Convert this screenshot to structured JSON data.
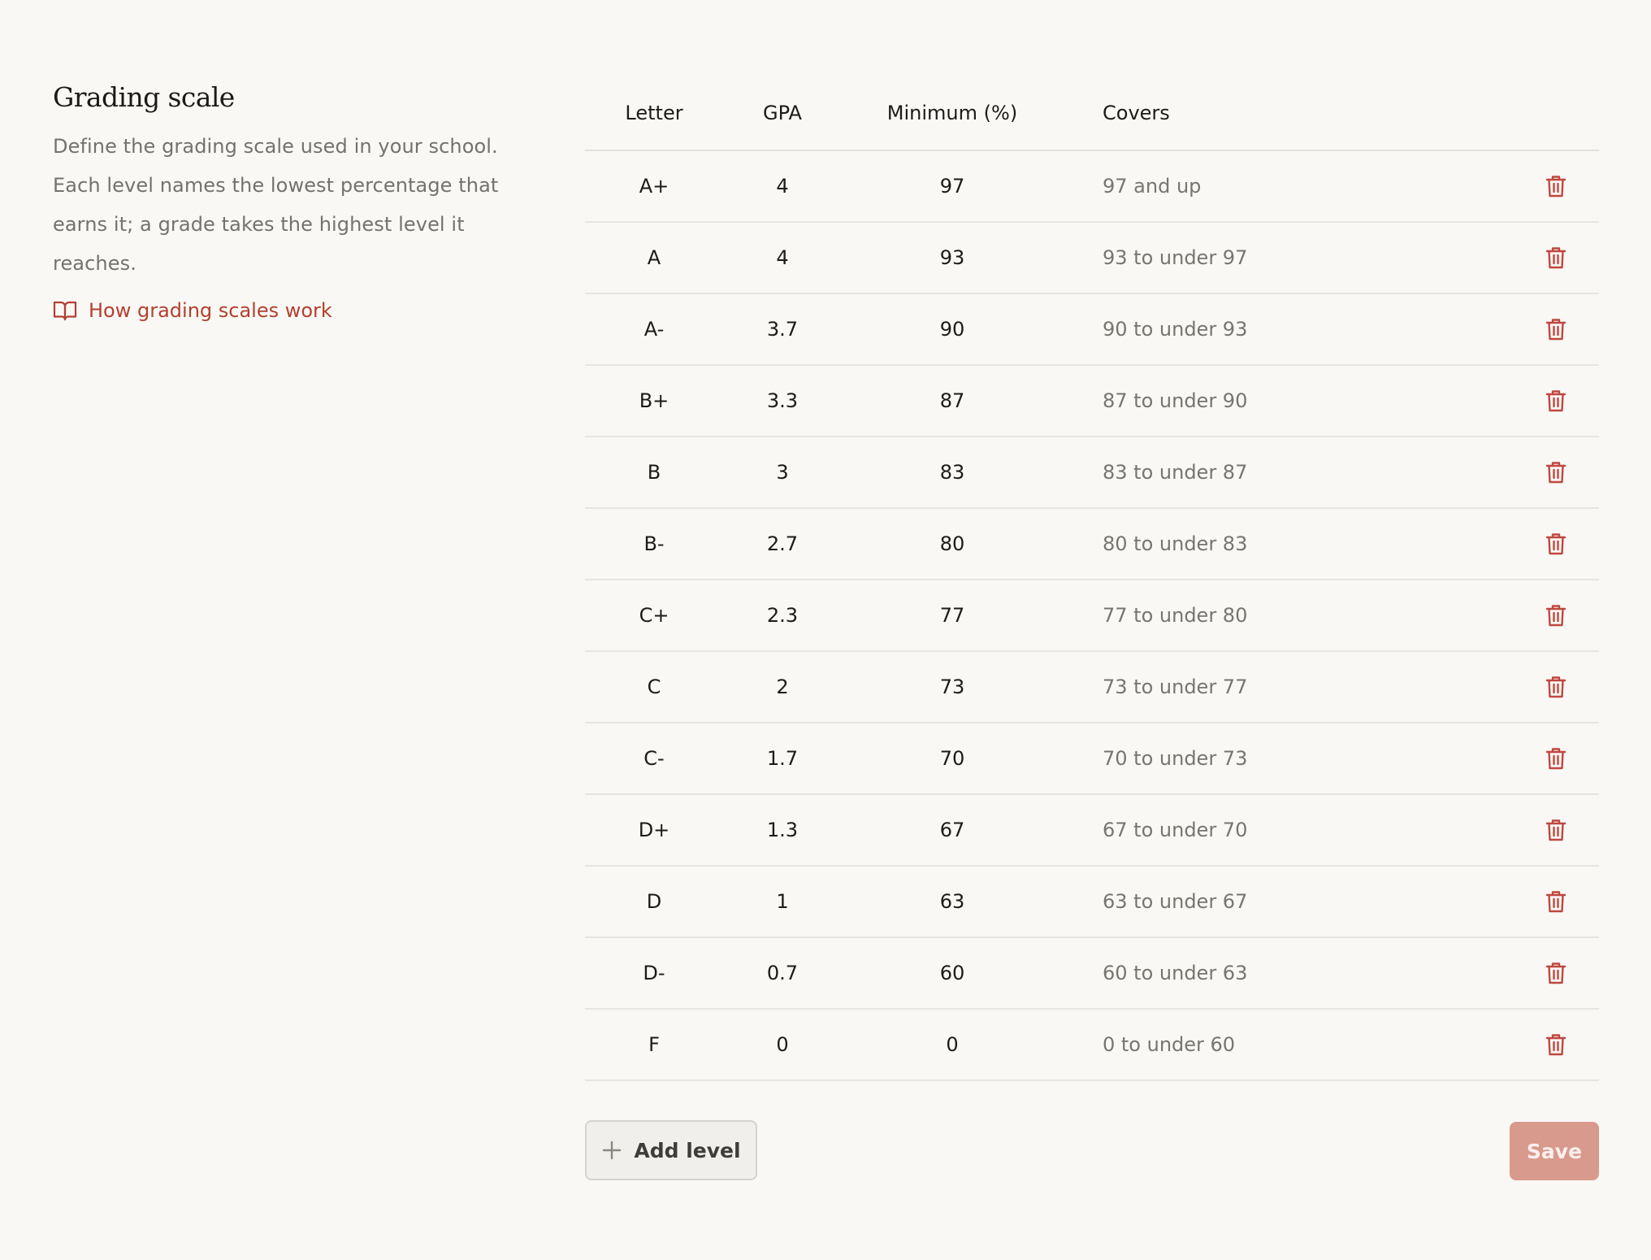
{
  "intro": {
    "title": "Grading scale",
    "description": "Define the grading scale used in your school. Each level names the lowest percentage that earns it; a grade takes the highest level it reaches.",
    "help_link": "How grading scales work"
  },
  "table": {
    "headers": {
      "letter": "Letter",
      "gpa": "GPA",
      "minimum": "Minimum (%)",
      "covers": "Covers"
    },
    "rows": [
      {
        "letter": "A+",
        "gpa": "4",
        "minimum": "97",
        "covers": "97 and up"
      },
      {
        "letter": "A",
        "gpa": "4",
        "minimum": "93",
        "covers": "93 to under 97"
      },
      {
        "letter": "A-",
        "gpa": "3.7",
        "minimum": "90",
        "covers": "90 to under 93"
      },
      {
        "letter": "B+",
        "gpa": "3.3",
        "minimum": "87",
        "covers": "87 to under 90"
      },
      {
        "letter": "B",
        "gpa": "3",
        "minimum": "83",
        "covers": "83 to under 87"
      },
      {
        "letter": "B-",
        "gpa": "2.7",
        "minimum": "80",
        "covers": "80 to under 83"
      },
      {
        "letter": "C+",
        "gpa": "2.3",
        "minimum": "77",
        "covers": "77 to under 80"
      },
      {
        "letter": "C",
        "gpa": "2",
        "minimum": "73",
        "covers": "73 to under 77"
      },
      {
        "letter": "C-",
        "gpa": "1.7",
        "minimum": "70",
        "covers": "70 to under 73"
      },
      {
        "letter": "D+",
        "gpa": "1.3",
        "minimum": "67",
        "covers": "67 to under 70"
      },
      {
        "letter": "D",
        "gpa": "1",
        "minimum": "63",
        "covers": "63 to under 67"
      },
      {
        "letter": "D-",
        "gpa": "0.7",
        "minimum": "60",
        "covers": "60 to under 63"
      },
      {
        "letter": "F",
        "gpa": "0",
        "minimum": "0",
        "covers": "0 to under 60"
      }
    ],
    "delete_icon": "trash-icon"
  },
  "footer": {
    "add_label": "Add level",
    "add_icon": "plus-icon",
    "save_label": "Save"
  },
  "colors": {
    "accent": "#b2402e",
    "delete_icon": "#c0473f",
    "save_disabled": "#d89a8c",
    "background": "#f9f8f5"
  }
}
